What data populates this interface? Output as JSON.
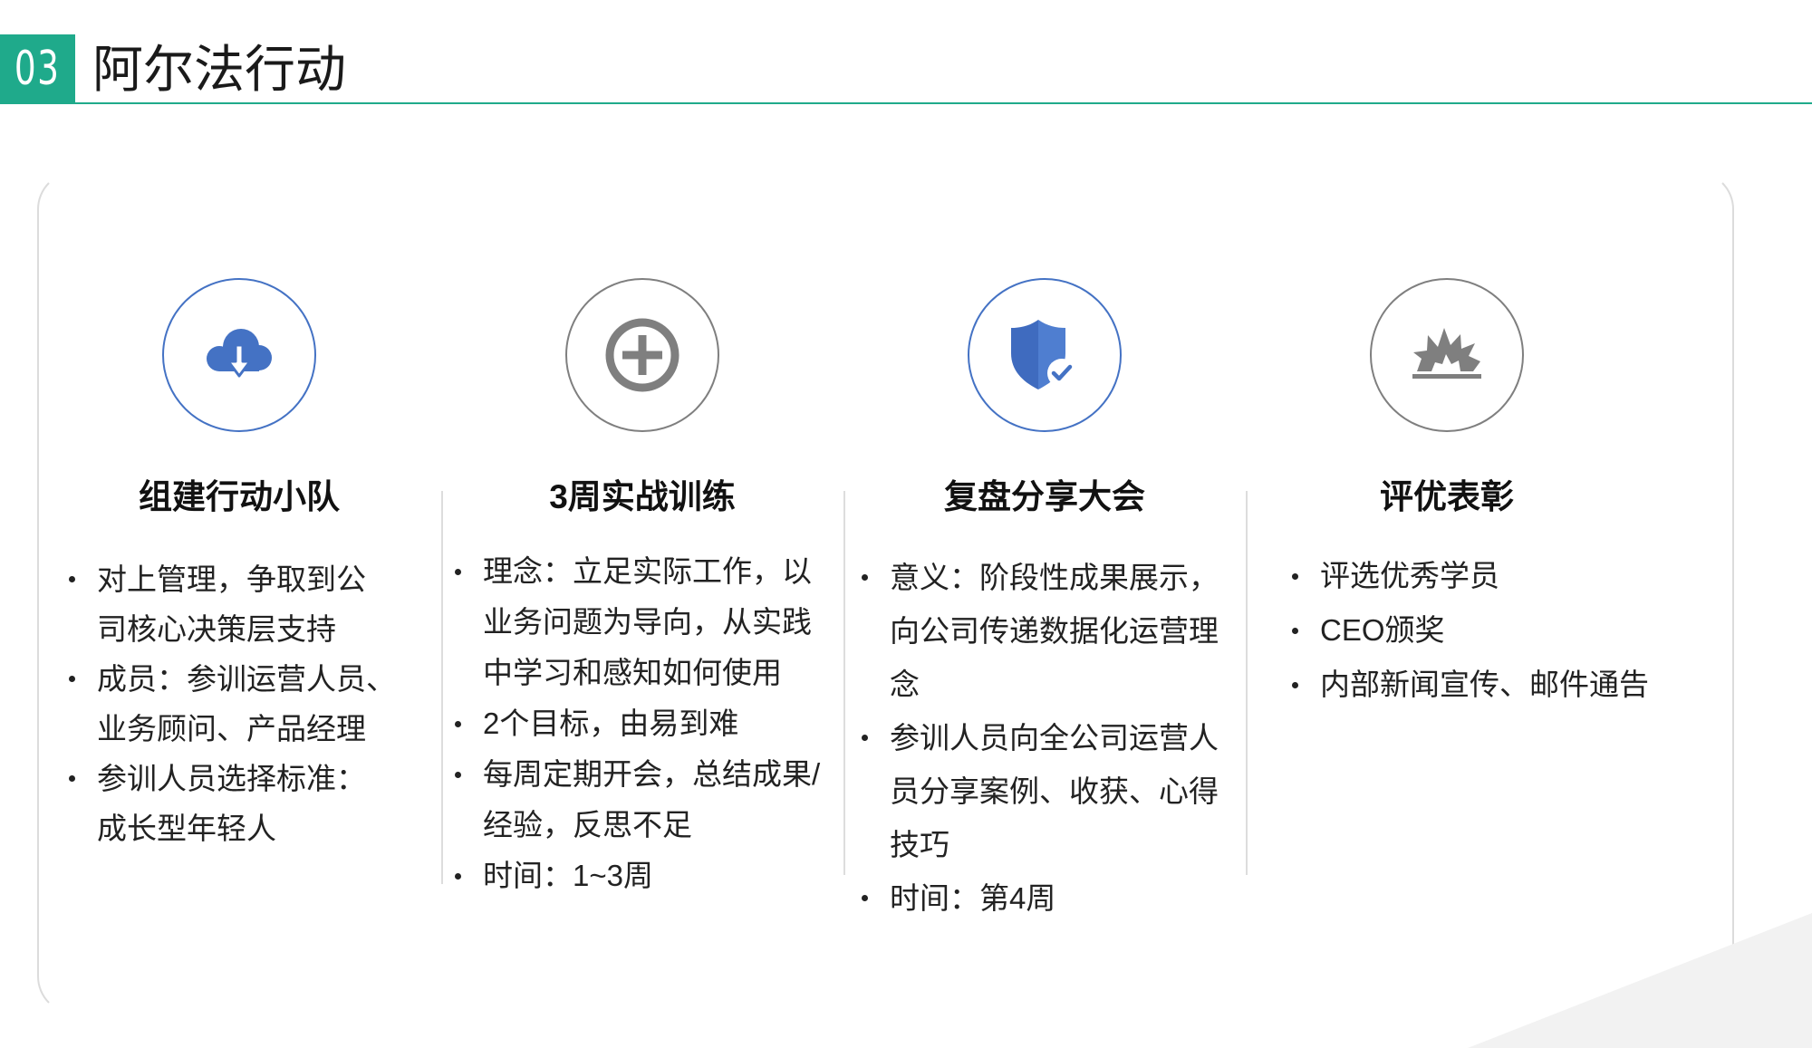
{
  "header": {
    "section_number": "03",
    "title": "阿尔法行动"
  },
  "colors": {
    "accent_teal": "#1FAA8B",
    "icon_blue": "#4472C4",
    "icon_gray": "#7F7F7F"
  },
  "columns": [
    {
      "icon": "cloud-download-icon",
      "heading": "组建行动小队",
      "bullets": [
        {
          "lines": [
            "对上管理，争取到公",
            "司核心决策层支持"
          ]
        },
        {
          "lines": [
            "成员：参训运营人员、",
            "业务顾问、产品经理"
          ]
        },
        {
          "lines": [
            "参训人员选择标准：",
            "成长型年轻人"
          ]
        }
      ]
    },
    {
      "icon": "plus-circle-icon",
      "heading": "3周实战训练",
      "bullets": [
        {
          "lines": [
            "理念：立足实际工作，以",
            "业务问题为导向，从实践",
            "中学习和感知如何使用"
          ]
        },
        {
          "lines": [
            "2个目标，由易到难"
          ]
        },
        {
          "lines": [
            "每周定期开会，总结成果/",
            "经验，反思不足"
          ]
        },
        {
          "lines": [
            "时间：1~3周"
          ]
        }
      ]
    },
    {
      "icon": "shield-check-icon",
      "heading": "复盘分享大会",
      "bullets": [
        {
          "lines": [
            "意义：阶段性成果展示，",
            "向公司传递数据化运营理",
            "念"
          ]
        },
        {
          "lines": [
            "参训人员向全公司运营人",
            "员分享案例、收获、心得",
            "技巧"
          ]
        },
        {
          "lines": [
            "时间：第4周"
          ]
        }
      ]
    },
    {
      "icon": "explosion-icon",
      "heading": "评优表彰",
      "bullets": [
        {
          "lines": [
            "评选优秀学员"
          ]
        },
        {
          "lines": [
            "CEO颁奖"
          ]
        },
        {
          "lines": [
            "内部新闻宣传、邮件通告"
          ]
        }
      ]
    }
  ]
}
